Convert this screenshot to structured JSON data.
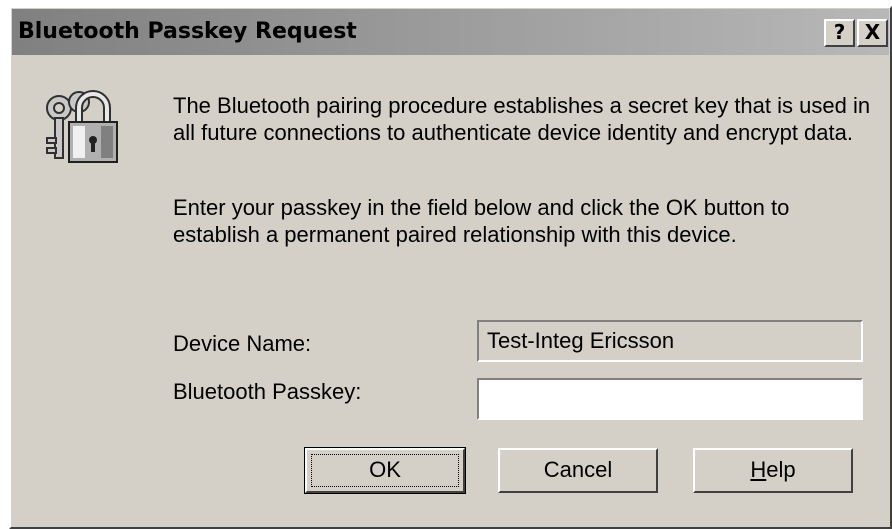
{
  "window": {
    "title": "Bluetooth Passkey Request",
    "help_button": "?",
    "close_button": "X"
  },
  "message": {
    "paragraph1": "The Bluetooth pairing procedure establishes a secret key that is used in all future connections to authenticate device identity and encrypt data.",
    "paragraph2": "Enter your passkey in the field below and click the OK button to establish a permanent paired relationship with this device."
  },
  "form": {
    "device_name_label": "Device Name:",
    "device_name_value": "Test-Integ Ericsson",
    "passkey_label": "Bluetooth Passkey:",
    "passkey_value": ""
  },
  "buttons": {
    "ok": "OK",
    "cancel": "Cancel",
    "help_first": "H",
    "help_rest": "elp"
  },
  "icons": {
    "dialog_icon": "lock-and-keys-icon"
  },
  "colors": {
    "dialog_face": "#d4d0c8",
    "title_gradient_start": "#808080",
    "title_gradient_end": "#b8b8b8"
  }
}
